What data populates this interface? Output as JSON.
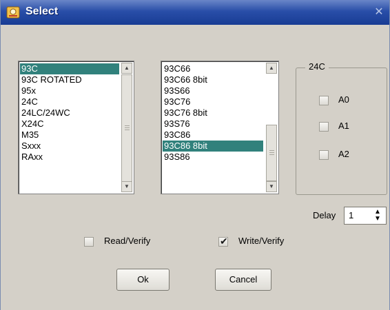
{
  "window": {
    "title": "Select",
    "close_glyph": "✕"
  },
  "left_list": {
    "items": [
      "93C",
      "93C ROTATED",
      "95x",
      "24C",
      "24LC/24WC",
      "X24C",
      "M35",
      "Sxxx",
      "RAxx"
    ],
    "selected_index": 0
  },
  "right_list": {
    "items": [
      "93C66",
      "93C66 8bit",
      "93S66",
      "93C76",
      "93C76 8bit",
      "93S76",
      "93C86",
      "93C86 8bit",
      "93S86"
    ],
    "selected_index": 7
  },
  "group_24c": {
    "title": "24C",
    "options": [
      {
        "label": "A0",
        "checked": false
      },
      {
        "label": "A1",
        "checked": false
      },
      {
        "label": "A2",
        "checked": false
      }
    ]
  },
  "delay": {
    "label": "Delay",
    "value": "1"
  },
  "read_verify": {
    "label": "Read/Verify",
    "checked": false
  },
  "write_verify": {
    "label": "Write/Verify",
    "checked": true
  },
  "buttons": {
    "ok": "Ok",
    "cancel": "Cancel"
  },
  "colors": {
    "selection": "#31817c",
    "title_bar": "#294ea8",
    "dialog_bg": "#d4d0c8"
  }
}
